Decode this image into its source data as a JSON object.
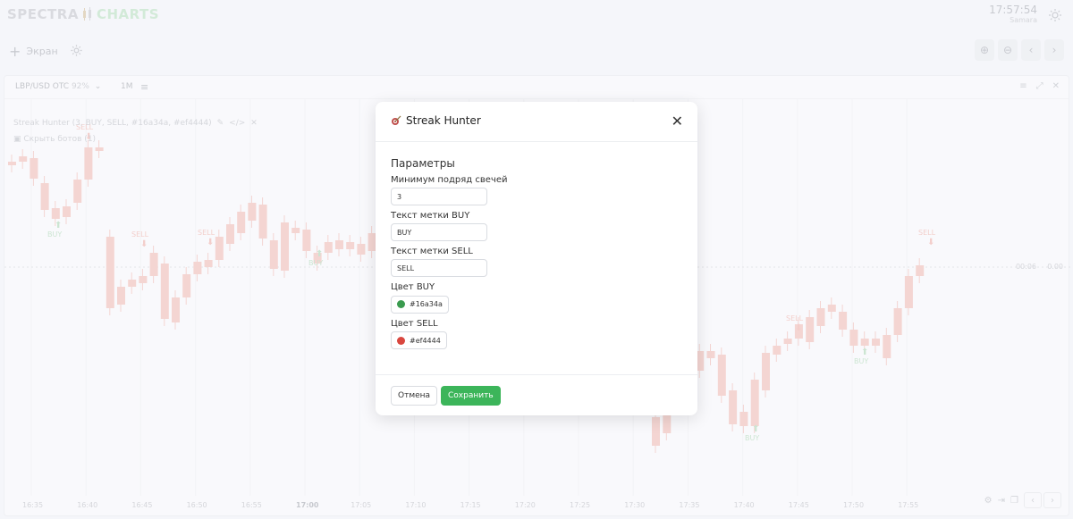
{
  "brand": {
    "part1": "SPECTRA",
    "part2": "CHARTS"
  },
  "clock": {
    "time": "17:57:54",
    "timezone": "Samara"
  },
  "toolbar": {
    "add_screen_label": "Экран"
  },
  "panel": {
    "pair": "LBP/USD OTC",
    "payout": "92%",
    "timeframe": "1M",
    "indicator_label": "Streak Hunter (3, BUY, SELL, #16a34a, #ef4444)",
    "hide_bots_label": "Скрыть ботов (1)",
    "countdown": "00:06",
    "price_value": "0.00",
    "time_labels": [
      "16:35",
      "16:40",
      "16:45",
      "16:50",
      "16:55",
      "17:00",
      "17:05",
      "17:10",
      "17:15",
      "17:20",
      "17:25",
      "17:30",
      "17:35",
      "17:40",
      "17:45",
      "17:50",
      "17:55"
    ]
  },
  "colors": {
    "buy": "#16a34a",
    "sell": "#ef4444",
    "accent": "#3cb55a"
  },
  "modal": {
    "title": "Streak Hunter",
    "section_title": "Параметры",
    "fields": {
      "min_candles": {
        "label": "Минимум подряд свечей",
        "value": "3"
      },
      "buy_text": {
        "label": "Текст метки BUY",
        "value": "BUY"
      },
      "sell_text": {
        "label": "Текст метки SELL",
        "value": "SELL"
      },
      "buy_color": {
        "label": "Цвет BUY",
        "value": "#16a34a"
      },
      "sell_color": {
        "label": "Цвет SELL",
        "value": "#ef4444"
      }
    },
    "cancel_label": "Отмена",
    "save_label": "Сохранить"
  },
  "markers": {
    "buy": "BUY",
    "sell": "SELL"
  }
}
